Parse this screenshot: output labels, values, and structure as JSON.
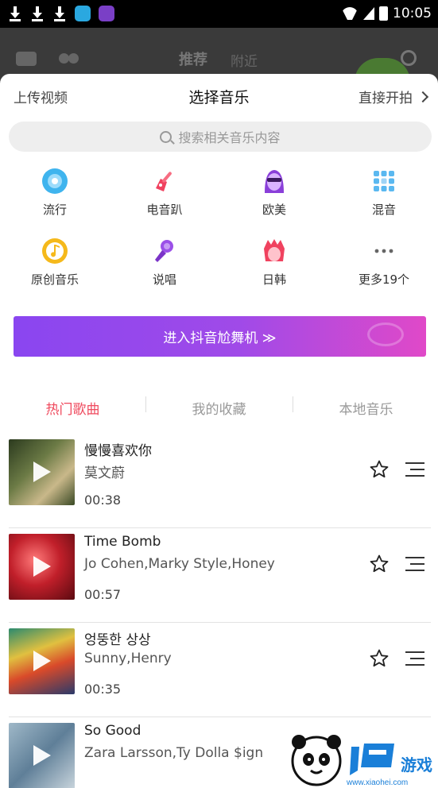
{
  "status_bar": {
    "time": "10:05"
  },
  "background_header": {
    "tab_recommend": "推荐",
    "tab_nearby": "附近"
  },
  "sheet": {
    "upload_label": "上传视频",
    "title": "选择音乐",
    "direct_start_label": "直接开拍",
    "search_placeholder": "搜索相关音乐内容"
  },
  "genres": [
    {
      "label": "流行",
      "icon": "disc-icon"
    },
    {
      "label": "电音趴",
      "icon": "guitar-icon"
    },
    {
      "label": "欧美",
      "icon": "sunglasses-face-icon"
    },
    {
      "label": "混音",
      "icon": "grid-dots-icon"
    },
    {
      "label": "原创音乐",
      "icon": "music-note-icon"
    },
    {
      "label": "说唱",
      "icon": "microphone-icon"
    },
    {
      "label": "日韩",
      "icon": "anime-hair-icon"
    },
    {
      "label": "更多19个",
      "icon": "more-dots-icon"
    }
  ],
  "banner": {
    "label": "进入抖音尬舞机 ≫"
  },
  "tabs": [
    {
      "label": "热门歌曲",
      "active": true
    },
    {
      "label": "我的收藏",
      "active": false
    },
    {
      "label": "本地音乐",
      "active": false
    }
  ],
  "songs": [
    {
      "name": "慢慢喜欢你",
      "artist": "莫文蔚",
      "duration": "00:38"
    },
    {
      "name": "Time Bomb",
      "artist": "Jo Cohen,Marky Style,Honey",
      "duration": "00:57"
    },
    {
      "name": "엉뚱한 상상",
      "artist": "Sunny,Henry",
      "duration": "00:35"
    },
    {
      "name": "So Good",
      "artist": "Zara Larsson,Ty Dolla $ign",
      "duration": ""
    }
  ],
  "colors": {
    "accent": "#ef4a5e",
    "banner_start": "#8a46f0",
    "banner_end": "#e049c8"
  }
}
